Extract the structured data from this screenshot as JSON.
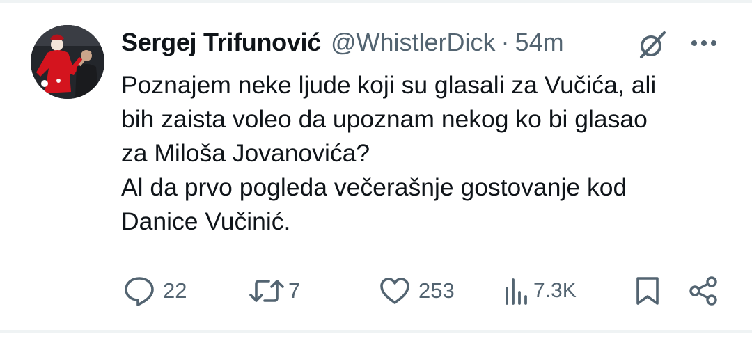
{
  "tweet": {
    "author_name": "Sergej Trifunović",
    "handle": "@WhistlerDick",
    "separator": "·",
    "time": "54m",
    "text_lines": [
      "Poznajem neke ljude koji su glasali za Vučića, ali",
      "bih zaista voleo da upoznam nekog ko bi glasao",
      "za Miloša Jovanovića?",
      "Al da prvo pogleda večerašnje gostovanje kod",
      "Danice Vučinić."
    ]
  },
  "actions": {
    "replies": "22",
    "reposts": "7",
    "likes": "253",
    "views": "7.3K"
  },
  "icons": {
    "grok": "grok-icon",
    "more": "more-icon",
    "reply": "reply-icon",
    "repost": "repost-icon",
    "like": "heart-icon",
    "views": "views-icon",
    "bookmark": "bookmark-icon",
    "share": "share-icon"
  },
  "colors": {
    "text": "#0f1419",
    "secondary": "#536471",
    "divider": "#eff3f4"
  }
}
